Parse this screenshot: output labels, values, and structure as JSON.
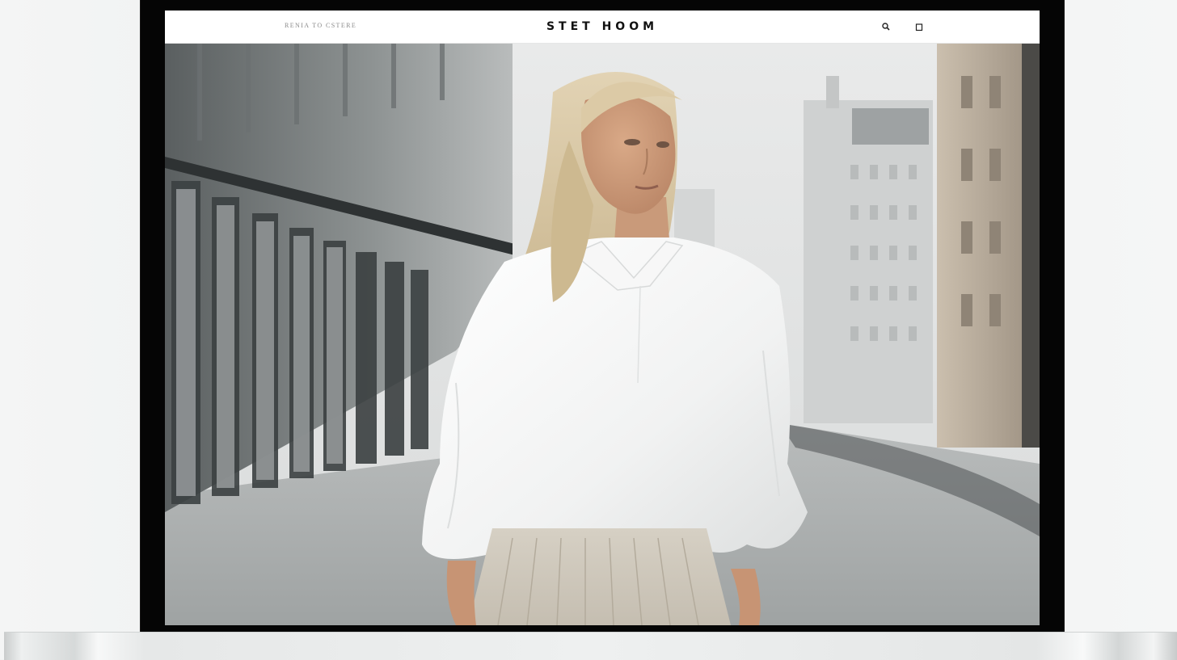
{
  "site": {
    "nav_link": "RENIA TO CSTERE",
    "logo": "STET HOOM"
  },
  "icons": {
    "search": "search-icon",
    "bag": "bag-icon"
  },
  "hero": {
    "image": "fashion-model-white-shirt-street-photo"
  },
  "colors": {
    "bezel": "#050505",
    "header_bg": "#ffffff",
    "logo_text": "#111111"
  }
}
